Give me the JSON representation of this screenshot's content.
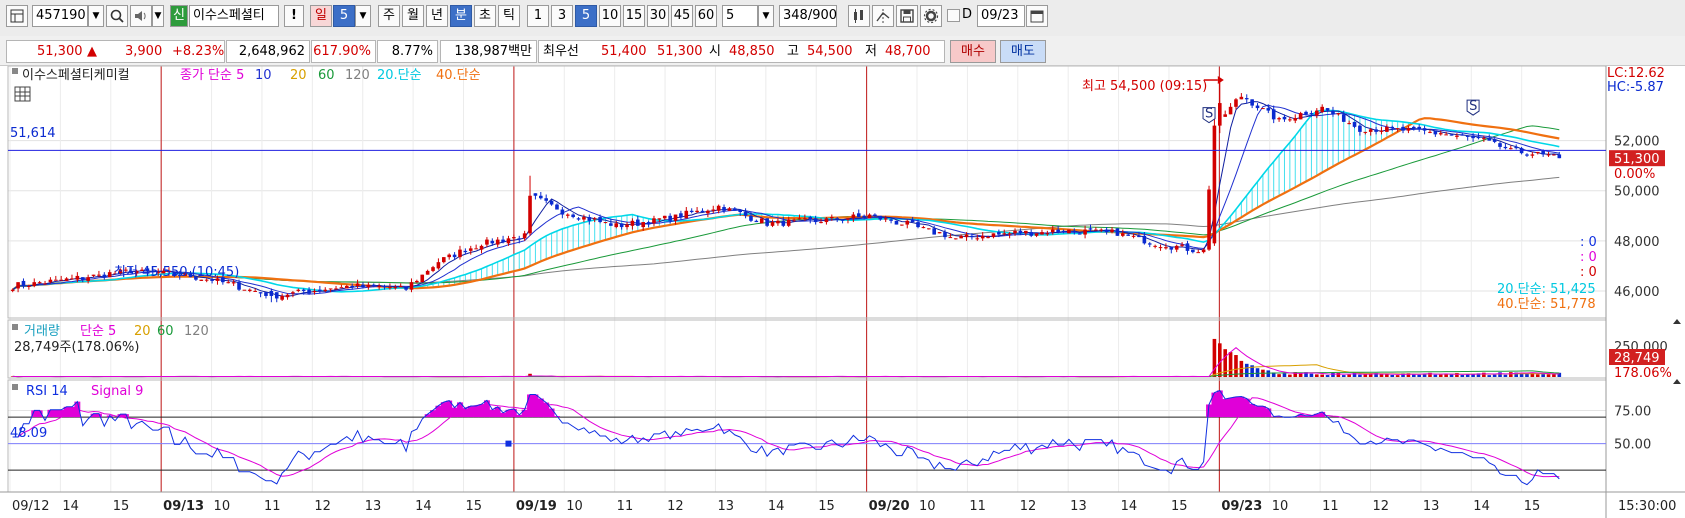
{
  "toolbar": {
    "code": "457190",
    "name": "이수스페셜티",
    "credit_badge": "신",
    "warn_label": "!",
    "period_label": "일",
    "period_value": "5",
    "periods": [
      "주",
      "월",
      "년"
    ],
    "minute_label": "분",
    "tick_label": "초",
    "tick2_label": "틱",
    "minutes": [
      "1",
      "3",
      "5",
      "10",
      "15",
      "30",
      "45",
      "60"
    ],
    "count_value": "5",
    "bar_count": "348",
    "bar_total": "/900",
    "date_checkbox": "D",
    "date_value": "09/23"
  },
  "quote": {
    "price": "51,300",
    "arrow": "▲",
    "change": "3,900",
    "change_pct": "+8.23%",
    "volume": "2,648,962",
    "volume_ratio": "617.90%",
    "turnover": "8.77%",
    "amount": "138,987백만",
    "best_label": "최우선",
    "best_ask": "51,400",
    "best_bid": "51,300",
    "open_label": "시",
    "open": "48,850",
    "high_label": "고",
    "high": "54,500",
    "low_label": "저",
    "low": "48,700",
    "buy_label": "매수",
    "sell_label": "매도"
  },
  "colors": {
    "price_up": "#d20000",
    "price_down": "#0a2ad0",
    "ma5": "#1020a0",
    "ma10": "#2030d0",
    "ma20": "#00d8e8",
    "ma40": "#f07010",
    "ma60": "#1a9a3a",
    "ma120": "#808080",
    "rsi": "#1030e0",
    "signal": "#e000d8",
    "current_line": "#2020e0"
  },
  "chart_data": {
    "type": "candlestick",
    "interval_minutes": 5,
    "main_title": "이수스페셜티케미컬",
    "legend": [
      {
        "label": "종가 단순 5",
        "color": "#e000d8"
      },
      {
        "label": "10",
        "color": "#2030d0"
      },
      {
        "label": "20",
        "color": "#d8a000"
      },
      {
        "label": "60",
        "color": "#1a9a3a"
      },
      {
        "label": "120",
        "color": "#808080"
      },
      {
        "label": "20.단순",
        "color": "#00c8e0"
      },
      {
        "label": "40.단순",
        "color": "#f07010"
      }
    ],
    "y_ticks": [
      "52,000",
      "50,000",
      "48,000",
      "46,000"
    ],
    "y_tick_values": [
      52000,
      50000,
      48000,
      46000
    ],
    "ylim": [
      45000,
      54900
    ],
    "reference_line": {
      "label": "51,614",
      "value": 51614
    },
    "current_price": {
      "label": "51,300",
      "value": 51300,
      "pct": "0.00%"
    },
    "lc_label": "LC:12.62",
    "hc_label": "HC:-5.87",
    "high_annotation": "최고 54,500 (09:15)",
    "low_annotation": "최저 45,550 (10:45)",
    "ma20_readout": "20.단순: 51,425",
    "ma40_readout": "40.단순: 51,778",
    "zero_readouts": [
      ": 0",
      ": 0",
      ": 0"
    ],
    "signal_markers": [
      "S",
      "S"
    ],
    "session_dividers": [
      "09/13",
      "09/19",
      "09/20",
      "09/23"
    ],
    "x_labels": [
      "09/12",
      "14",
      "15",
      "09/13",
      "10",
      "11",
      "12",
      "13",
      "14",
      "15",
      "09/19",
      "10",
      "11",
      "12",
      "13",
      "14",
      "15",
      "09/20",
      "10",
      "11",
      "12",
      "13",
      "14",
      "15",
      "09/23",
      "10",
      "11",
      "12",
      "13",
      "14",
      "15"
    ],
    "time_label": "15:30:00",
    "anchors": [
      {
        "x": 0,
        "close": 46200
      },
      {
        "x": 12,
        "close": 46500
      },
      {
        "x": 22,
        "close": 46800
      },
      {
        "x": 33,
        "close": 46600
      },
      {
        "x": 40,
        "close": 46300
      },
      {
        "x": 48,
        "close": 45800
      },
      {
        "x": 55,
        "close": 46000
      },
      {
        "x": 63,
        "close": 46200
      },
      {
        "x": 73,
        "close": 46100
      },
      {
        "x": 79,
        "close": 47200
      },
      {
        "x": 87,
        "close": 47900
      },
      {
        "x": 95,
        "close": 48200
      },
      {
        "x": 96,
        "close": 49800
      },
      {
        "x": 103,
        "close": 49100
      },
      {
        "x": 112,
        "close": 48600
      },
      {
        "x": 122,
        "close": 48900
      },
      {
        "x": 131,
        "close": 49400
      },
      {
        "x": 140,
        "close": 48700
      },
      {
        "x": 150,
        "close": 48800
      },
      {
        "x": 159,
        "close": 49000
      },
      {
        "x": 167,
        "close": 48600
      },
      {
        "x": 175,
        "close": 48100
      },
      {
        "x": 185,
        "close": 48300
      },
      {
        "x": 195,
        "close": 48400
      },
      {
        "x": 205,
        "close": 48300
      },
      {
        "x": 212,
        "close": 47900
      },
      {
        "x": 221,
        "close": 47600
      },
      {
        "x": 223,
        "close": 52600
      },
      {
        "x": 228,
        "close": 53800
      },
      {
        "x": 235,
        "close": 52800
      },
      {
        "x": 243,
        "close": 53300
      },
      {
        "x": 250,
        "close": 52500
      },
      {
        "x": 258,
        "close": 52400
      },
      {
        "x": 265,
        "close": 52300
      },
      {
        "x": 273,
        "close": 52000
      },
      {
        "x": 278,
        "close": 51600
      },
      {
        "x": 287,
        "close": 51300
      }
    ],
    "volume_panel": {
      "legend": [
        {
          "label": "거래량",
          "color": "#1aa0c0"
        },
        {
          "label": "단순 5",
          "color": "#e000d8"
        },
        {
          "label": "20",
          "color": "#d8a000"
        },
        {
          "label": "60",
          "color": "#1a9a3a"
        },
        {
          "label": "120",
          "color": "#808080"
        }
      ],
      "readout": "28,749주(178.06%)",
      "y_tick": "250,000",
      "current_label": "28,749",
      "current_pct": "178.06%",
      "last_volume": 28749,
      "ylim": [
        0,
        280000
      ]
    },
    "rsi_panel": {
      "legend": [
        {
          "label": "RSI 14",
          "color": "#1030e0"
        },
        {
          "label": "Signal 9",
          "color": "#e000d8"
        }
      ],
      "readout": "48.09",
      "y_ticks": [
        "75.00",
        "50.00"
      ],
      "y_tick_values": [
        75,
        50
      ],
      "guide_lines": [
        70,
        30
      ],
      "ylim": [
        15,
        95
      ]
    }
  }
}
